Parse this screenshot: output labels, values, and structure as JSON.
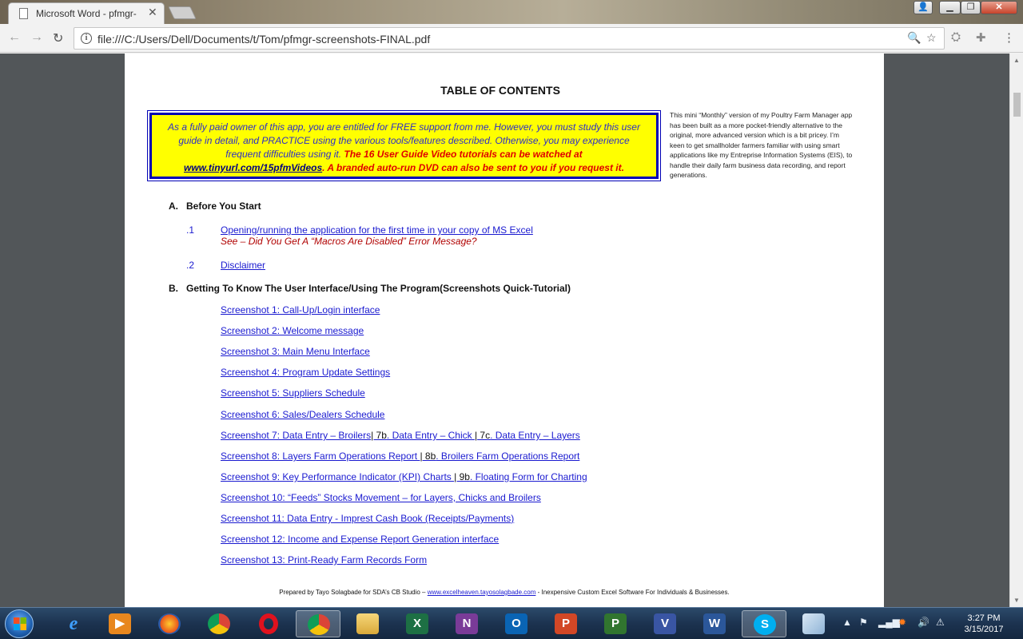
{
  "browser": {
    "tab_title": "Microsoft Word - pfmgr-",
    "url": "file:///C:/Users/Dell/Documents/t/Tom/pfmgr-screenshots-FINAL.pdf",
    "icons": {
      "back": "back-arrow-icon",
      "forward": "forward-arrow-icon",
      "reload": "reload-icon",
      "zoom": "zoom-icon",
      "star": "bookmark-star-icon",
      "extension": "extension-icon",
      "menu": "menu-icon"
    }
  },
  "document": {
    "title": "TABLE OF CONTENTS",
    "notice": {
      "text_plain": "As a fully paid owner of this app, you are entitled for FREE support from me. However, you must study this user guide in detail, and PRACTICE using the various tools/features described. Otherwise, you may experience frequent difficulties using it. ",
      "text_red": "The 16 User Guide Video tutorials can be watched at",
      "link": "www.tinyurl.com/15pfmVideos",
      "text_red_after": ". A branded auto-run DVD can also be sent to you if you request it."
    },
    "side_note": "This mini “Monthly” version of my Poultry Farm Manager app has been built as a more pocket-friendly alternative to the original, more advanced version which is a bit pricey. I’m keen to get smallholder farmers familiar with using smart applications like my Entreprise Information Systems (EIS), to handle their daily farm business data recording, and report generations.",
    "section_a": {
      "letter": "A.",
      "title": "Before You Start",
      "items": [
        {
          "num": ".1",
          "label": "Opening/running the application for the first time in your copy of MS Excel",
          "note": "See – Did You Get A “Macros Are Disabled” Error Message?"
        },
        {
          "num": ".2",
          "label": "Disclaimer"
        }
      ]
    },
    "section_b": {
      "letter": "B.",
      "title": "Getting To Know The User Interface/Using The Program(Screenshots Quick-Tutorial)",
      "links": [
        "Screenshot 1:  Call-Up/Login interface",
        "Screenshot 2: Welcome message",
        "Screenshot 3: Main Menu Interface",
        "Screenshot 4: Program Update Settings",
        "Screenshot 5: Suppliers Schedule",
        "Screenshot 6: Sales/Dealers Schedule"
      ],
      "ss7": {
        "a": "Screenshot 7: Data Entry – Broilers",
        "sep1": "| 7b",
        "b": ". Data Entry – Chick ",
        "sep2": "| 7c",
        "c": ". Data Entry – Layers"
      },
      "ss8": {
        "a": "Screenshot 8: Layers Farm Operations Report ",
        "sep": "| 8b",
        "b": ". Broilers Farm Operations Report"
      },
      "ss9": {
        "a": "Screenshot 9: Key Performance Indicator (KPI) Charts ",
        "sep": "| 9b",
        "b": ". Floating Form for Charting"
      },
      "links2": [
        "Screenshot 10: “Feeds” Stocks Movement – for Layers, Chicks and Broilers",
        "Screenshot 11: Data Entry - Imprest Cash Book (Receipts/Payments)",
        "Screenshot 12: Income and Expense Report Generation  interface",
        "Screenshot 13: Print-Ready Farm Records Form"
      ]
    },
    "footer": {
      "prefix": "Prepared by Tayo Solagbade for SDA’s CB Studio – ",
      "link": "www.excelheaven.tayosolagbade.com",
      "suffix": " - Inexpensive Custom Excel Software For Individuals & Businesses."
    }
  },
  "taskbar": {
    "apps": [
      "internet-explorer",
      "media-player",
      "firefox",
      "chrome",
      "opera",
      "chrome-active",
      "file-explorer",
      "excel",
      "onenote",
      "outlook",
      "powerpoint",
      "project",
      "visio",
      "word",
      "skype",
      "unknown-app"
    ],
    "time": "3:27 PM",
    "date": "3/15/2017"
  }
}
